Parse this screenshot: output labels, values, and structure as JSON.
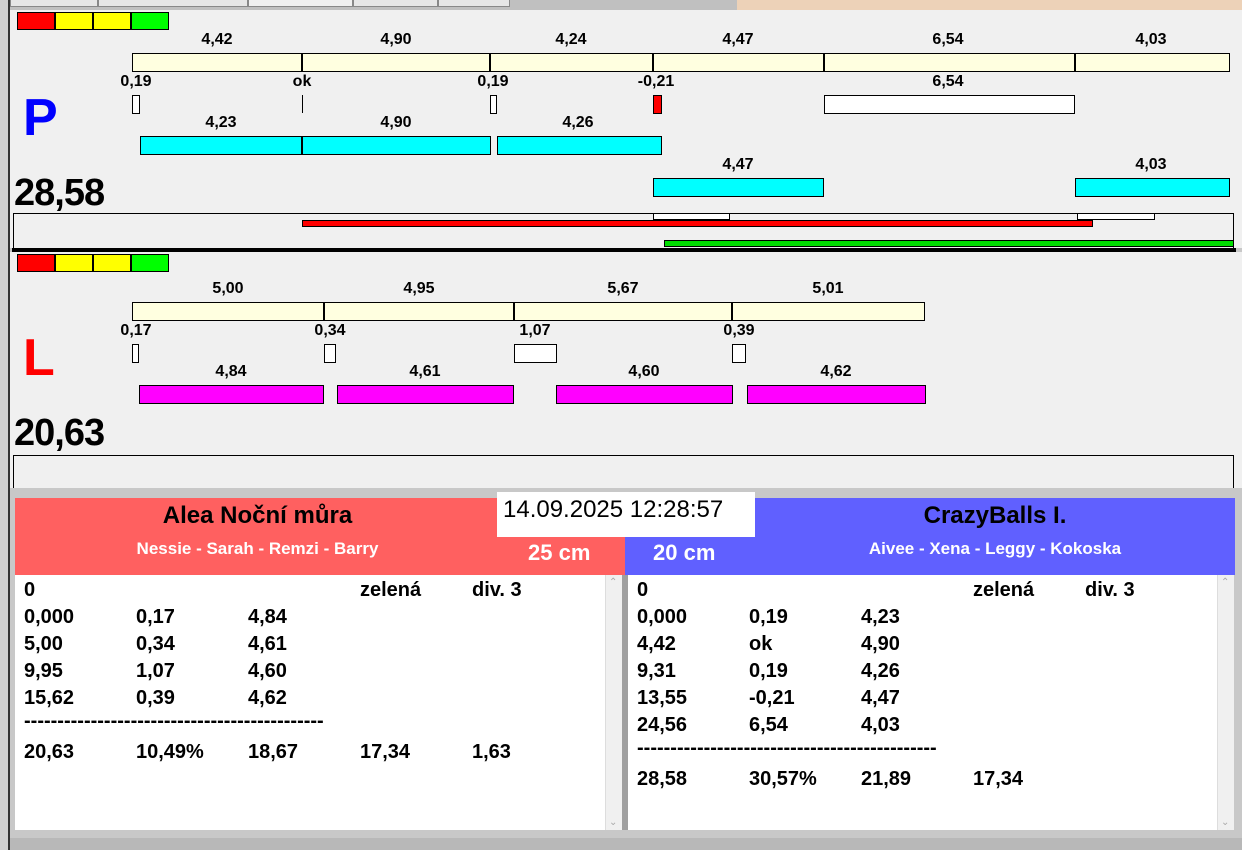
{
  "legend_colors": [
    "#ff0000",
    "#ffff00",
    "#ffff00",
    "#00ff00"
  ],
  "colors": {
    "cream": "#ffffe0",
    "cyan": "#00ffff",
    "magenta": "#ff00ff",
    "red": "#ff0000",
    "green": "#00dd00",
    "team_left": "#ff6060",
    "team_right": "#6060ff"
  },
  "top": {
    "letter": "P",
    "total": "28,58",
    "row1": [
      "4,42",
      "4,90",
      "4,24",
      "4,47",
      "6,54",
      "4,03"
    ],
    "row2": [
      "0,19",
      "ok",
      "0,19",
      "-0,21",
      "6,54"
    ],
    "row3": [
      "4,23",
      "4,90",
      "4,26"
    ],
    "row4": [
      "4,47",
      "4,03"
    ]
  },
  "bottom": {
    "letter": "L",
    "total": "20,63",
    "row1": [
      "5,00",
      "4,95",
      "5,67",
      "5,01"
    ],
    "row2": [
      "0,17",
      "0,34",
      "1,07",
      "0,39"
    ],
    "row3": [
      "4,84",
      "4,61",
      "4,60",
      "4,62"
    ]
  },
  "datetime": "14.09.2025 12:28:57",
  "left_team": {
    "name": "Alea Noční můra",
    "members": "Nessie - Sarah - Remzi - Barry",
    "size": "25 cm",
    "header": [
      "0",
      "",
      "",
      "zelená",
      "div. 3"
    ],
    "rows": [
      [
        "0,000",
        "0,17",
        "4,84"
      ],
      [
        "5,00",
        "0,34",
        "4,61"
      ],
      [
        "9,95",
        "1,07",
        "4,60"
      ],
      [
        "15,62",
        "0,39",
        "4,62"
      ]
    ],
    "separator": "---------------------------------------------",
    "summary": [
      "20,63",
      "10,49%",
      "18,67",
      "17,34",
      "1,63"
    ]
  },
  "right_team": {
    "name": "CrazyBalls I.",
    "members": "Aivee - Xena - Leggy - Kokoska",
    "size": "20 cm",
    "header": [
      "0",
      "",
      "",
      "zelená",
      "div. 3"
    ],
    "rows": [
      [
        "0,000",
        "0,19",
        "4,23"
      ],
      [
        "4,42",
        "ok",
        "4,90"
      ],
      [
        "9,31",
        "0,19",
        "4,26"
      ],
      [
        "13,55",
        "-0,21",
        "4,47"
      ],
      [
        "24,56",
        "6,54",
        "4,03"
      ]
    ],
    "separator": "---------------------------------------------",
    "summary": [
      "28,58",
      "30,57%",
      "21,89",
      "17,34"
    ]
  }
}
